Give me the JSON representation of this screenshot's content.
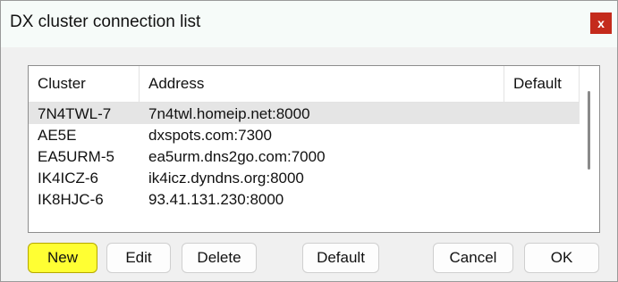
{
  "window": {
    "title": "DX cluster connection list",
    "close_glyph": "x"
  },
  "list": {
    "columns": {
      "cluster": "Cluster",
      "address": "Address",
      "default": "Default"
    },
    "rows": [
      {
        "cluster": "7N4TWL-7",
        "address": "7n4twl.homeip.net:8000",
        "selected": true
      },
      {
        "cluster": "AE5E",
        "address": "dxspots.com:7300",
        "selected": false
      },
      {
        "cluster": "EA5URM-5",
        "address": "ea5urm.dns2go.com:7000",
        "selected": false
      },
      {
        "cluster": "IK4ICZ-6",
        "address": "ik4icz.dyndns.org:8000",
        "selected": false
      },
      {
        "cluster": "IK8HJC-6",
        "address": "93.41.131.230:8000",
        "selected": false
      }
    ]
  },
  "buttons": {
    "new": "New",
    "edit": "Edit",
    "delete": "Delete",
    "default": "Default",
    "cancel": "Cancel",
    "ok": "OK"
  },
  "colors": {
    "new_button": "#ffff33",
    "close_button": "#c42b1c",
    "selected_row": "#e5e5e5"
  }
}
